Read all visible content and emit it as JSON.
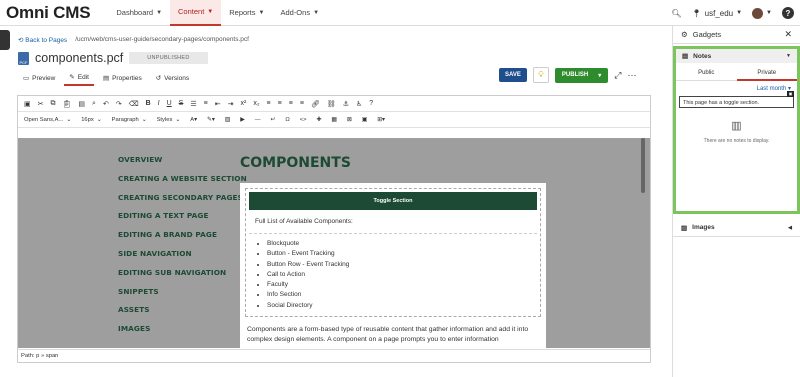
{
  "app": {
    "logo": "Omni CMS"
  },
  "nav": [
    {
      "label": "Dashboard",
      "active": false
    },
    {
      "label": "Content",
      "active": true
    },
    {
      "label": "Reports",
      "active": false
    },
    {
      "label": "Add-Ons",
      "active": false
    }
  ],
  "topright": {
    "site": "usf_edu"
  },
  "breadcrumb": {
    "back": "Back to Pages",
    "path": "/ucm/web/cms-user-guide/secondary-pages/components.pcf"
  },
  "file": {
    "icon_label": "PCF",
    "name": "components.pcf",
    "status": "UNPUBLISHED"
  },
  "tabs": [
    "Preview",
    "Edit",
    "Properties",
    "Versions"
  ],
  "actions": {
    "save": "SAVE",
    "publish": "PUBLISH"
  },
  "toolbar2": {
    "font": "Open Sans,A...",
    "size": "16px",
    "block": "Paragraph",
    "styles": "Styles"
  },
  "page": {
    "sidenav": [
      "OVERVIEW",
      "CREATING A WEBSITE SECTION",
      "CREATING SECONDARY PAGES",
      "EDITING A TEXT PAGE",
      "EDITING A BRAND PAGE",
      "SIDE NAVIGATION",
      "EDITING SUB NAVIGATION",
      "SNIPPETS",
      "ASSETS",
      "IMAGES"
    ],
    "title": "COMPONENTS",
    "toggle_heading": "Toggle Section",
    "toggle_sub": "Full List of Available Components:",
    "toggle_items": [
      "Blockquote",
      "Button - Event Tracking",
      "Button Row - Event Tracking",
      "Call to Action",
      "Faculty",
      "Info Section",
      "Social Directory"
    ],
    "paragraph": "Components are a form-based type of reusable content that gather information and add it into complex design elements. A component on a page prompts you to enter information"
  },
  "path": "Path:  p » span",
  "gadgets": {
    "title": "Gadgets",
    "notes_title": "Notes",
    "tab_public": "Public",
    "tab_private": "Private",
    "filter": "Last month",
    "note_text": "This page has a toggle section.",
    "empty": "There are no notes to display.",
    "images_title": "Images"
  },
  "colors": {
    "accent_red": "#c0392b",
    "publish_green": "#2e8b2e",
    "save_blue": "#1f4e8c",
    "notes_border": "#7cc45c",
    "brand_green": "#1c4a34"
  }
}
